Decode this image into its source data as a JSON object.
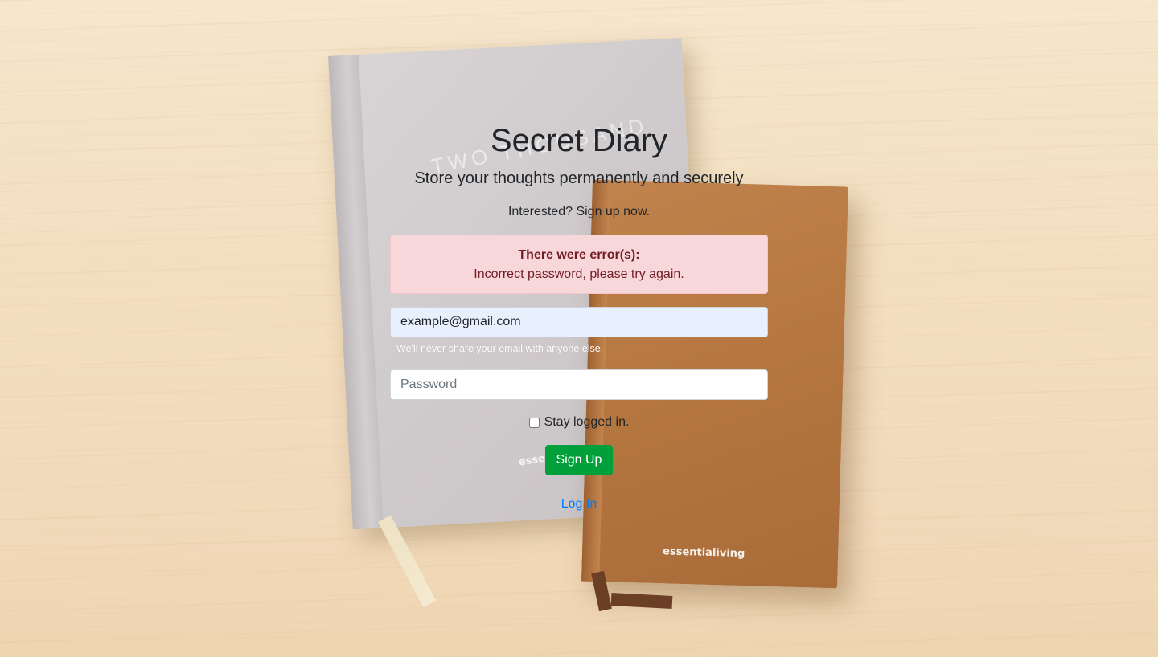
{
  "header": {
    "title": "Secret Diary",
    "subtitle": "Store your thoughts permanently and securely",
    "cta": "Interested? Sign up now."
  },
  "alert": {
    "title": "There were error(s):",
    "message": "Incorrect password, please try again."
  },
  "form": {
    "email_value": "example@gmail.com",
    "email_help": "We'll never share your email with anyone else.",
    "password_placeholder": "Password",
    "remember_label": "Stay logged in.",
    "remember_checked": false,
    "submit_label": "Sign Up",
    "toggle_link": "Log In"
  },
  "background": {
    "grey_book_emboss": "TWO THOUSAND",
    "grey_book_brand": "essentialiving",
    "brown_book_brand": "essentialiving"
  },
  "colors": {
    "submit": "#02a03a",
    "alert_bg": "#f8d7da",
    "alert_text": "#721c24",
    "link": "#007bff"
  }
}
